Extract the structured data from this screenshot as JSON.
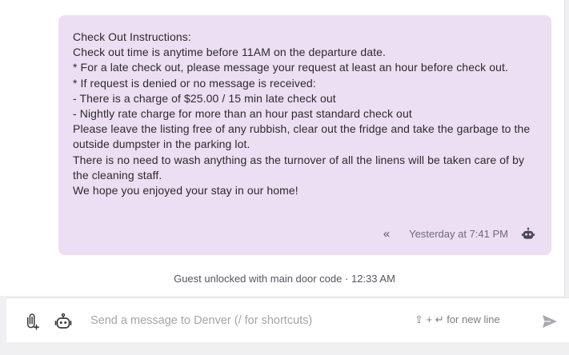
{
  "message": {
    "text": "Check Out Instructions:\nCheck out time is anytime before 11AM on the departure date.\n* For a late check out, please message your request at least an hour before check out.\n* If request is denied or no message is received:\n- There is a charge of $25.00 / 15 min late check out\n- Nightly rate charge for more than an hour past standard check out\nPlease leave the listing free of any rubbish, clear out the fridge and take the garbage to the outside dumpster in the parking lot.\nThere is no need to wash anything as the turnover of all the linens will be taken care of by the cleaning staff.\nWe hope you enjoyed your stay in our home!",
    "timestamp": "Yesterday at 7:41 PM",
    "chevron_icon": "double-chevron-left-icon",
    "sender_icon": "robot-icon",
    "bubble_color": "#ecdff3"
  },
  "event": {
    "text": "Guest unlocked with main door code",
    "separator": "·",
    "time": "12:33 AM"
  },
  "composer": {
    "placeholder": "Send a message to Denver (/ for shortcuts)",
    "hint": "⇧ + ↵ for new line",
    "attach_icon": "paperclip-add-icon",
    "bot_icon": "robot-icon",
    "send_icon": "send-icon"
  }
}
